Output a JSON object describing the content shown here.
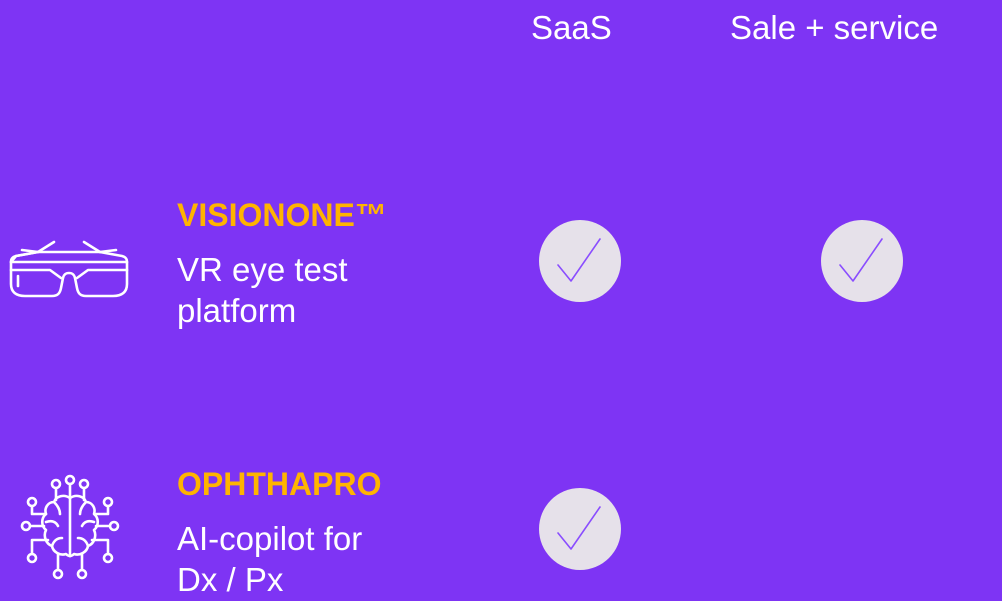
{
  "columns": {
    "saas": "SaaS",
    "sale_service": "Sale + service"
  },
  "products": [
    {
      "name": "VISIONONE™",
      "description_line1": "VR eye test",
      "description_line2": "platform",
      "icon": "vr-glasses-icon",
      "saas": true,
      "sale_service": true
    },
    {
      "name": "OPHTHAPRO",
      "description_line1": "AI-copilot for",
      "description_line2": "Dx / Px",
      "icon": "ai-brain-icon",
      "saas": true,
      "sale_service": false
    }
  ],
  "colors": {
    "background": "#7e34f4",
    "product_name": "#ffb400",
    "text": "#ffffff",
    "check_circle": "#e6e1ea",
    "check_mark": "#8a4dff"
  }
}
